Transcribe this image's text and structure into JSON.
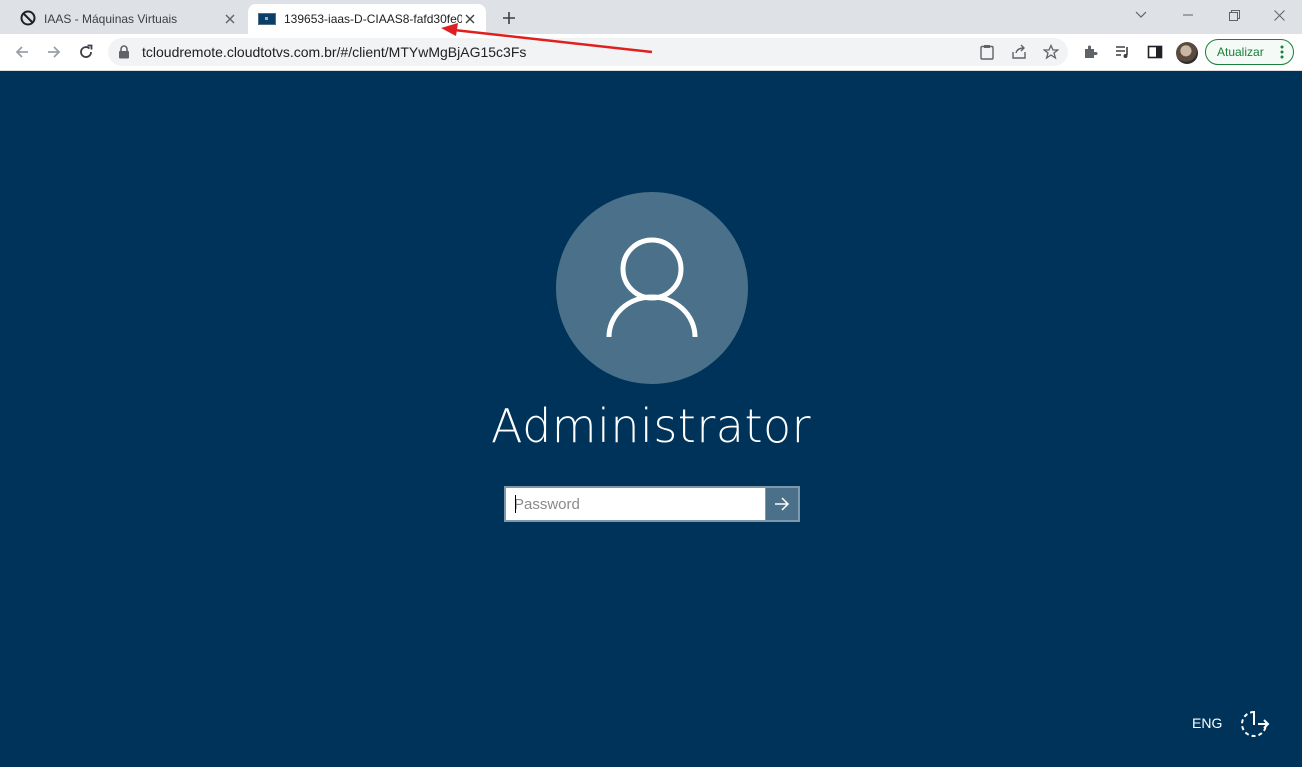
{
  "tabs": [
    {
      "title": "IAAS - Máquinas Virtuais",
      "active": false,
      "icon": "circle-slash-icon"
    },
    {
      "title": "139653-iaas-D-CIAAS8-fafd30fe0",
      "active": true,
      "icon": "vm-screen-icon"
    }
  ],
  "address_bar": {
    "url": "tcloudremote.cloudtotvs.com.br/#/client/MTYwMgBjAG15c3Fs"
  },
  "toolbar": {
    "update_label": "Atualizar"
  },
  "login": {
    "username": "Administrator",
    "password_placeholder": "Password",
    "password_value": ""
  },
  "footer": {
    "language": "ENG"
  },
  "colors": {
    "background": "#003359",
    "avatar_circle": "#4a7189",
    "update_green": "#188038",
    "annotation_arrow": "#e02020"
  }
}
